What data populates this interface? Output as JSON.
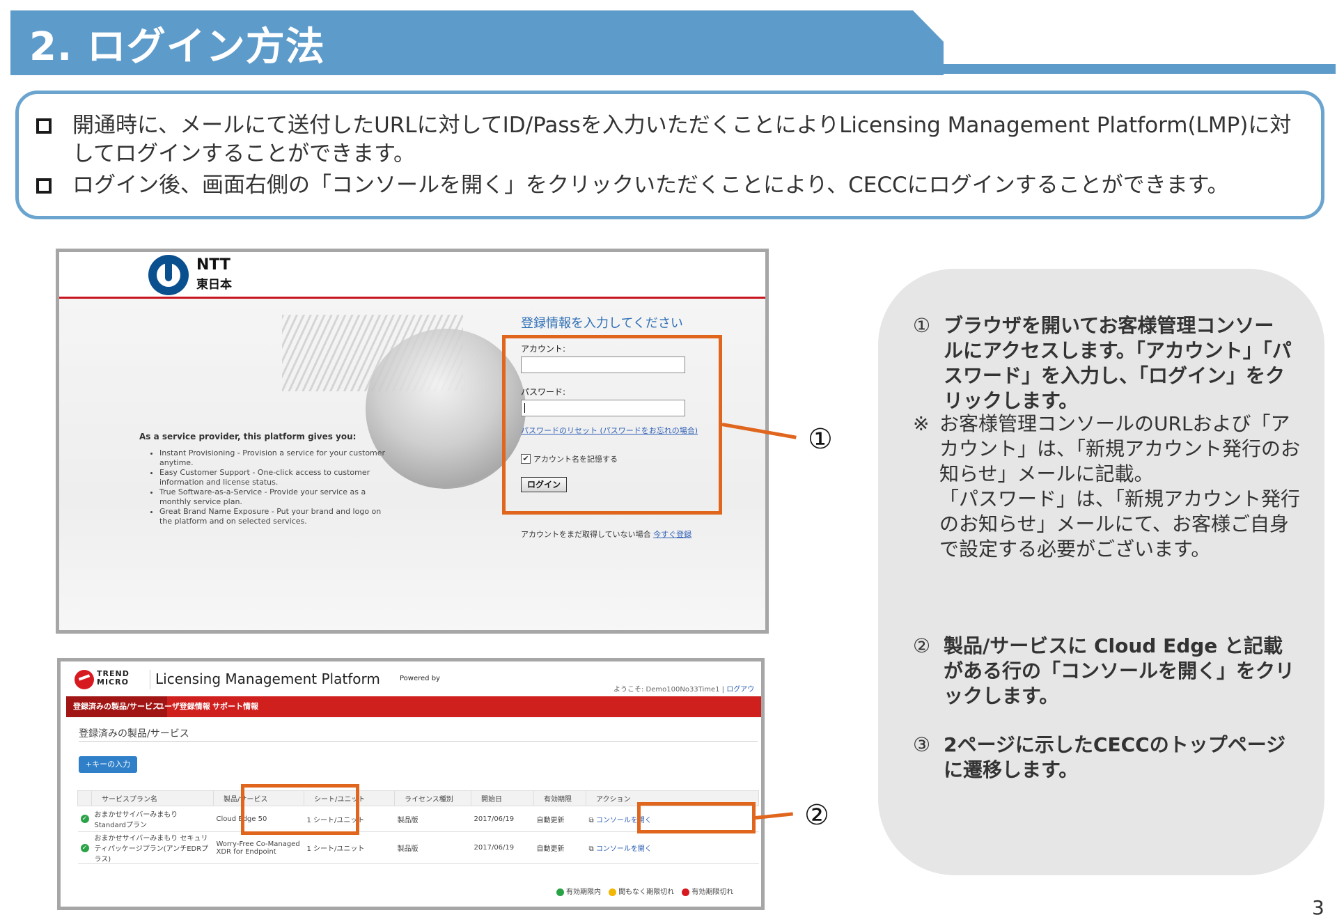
{
  "header": {
    "title": "2.  ログイン方法",
    "band_color": "#5d9bcb"
  },
  "intro": {
    "bullets": [
      "開通時に、メールにて送付したURLに対してID/Passを入力いただくことによりLicensing Management Platform(LMP)に対してログインすることができます。",
      "ログイン後、画面右側の「コンソールを開く」をクリックいただくことにより、CECCにログインすることができます。"
    ]
  },
  "login_screen": {
    "logo_line1": "NTT",
    "logo_line2": "東日本",
    "heading": "登録情報を入力してください",
    "account_label": "アカウント:",
    "password_label": "パスワード:",
    "password_reset": "パスワードのリセット (パスワードをお忘れの場合)",
    "remember_label": "アカウント名を記憶する",
    "remember_checked": true,
    "login_button": "ログイン",
    "no_account_text": "アカウントをまだ取得していない場合",
    "register_link": "今すぐ登録",
    "provider_title": "As a service provider, this platform gives you:",
    "provider_points": [
      "Instant Provisioning - Provision a service for your customer anytime.",
      "Easy Customer Support - One-click access to customer information and license status.",
      "True Software-as-a-Service - Provide your service as a monthly service plan.",
      "Great Brand Name Exposure - Put your brand and logo on the platform and on selected services."
    ]
  },
  "lmp_screen": {
    "brand": "TREND MICRO",
    "title": "Licensing Management Platform",
    "powered_by": "Powered by",
    "welcome": "ようこそ: Demo100No33Time1 |",
    "logout": "ログアウト",
    "tabs": [
      "登録済みの製品/サービス",
      "ユーザ登録情報",
      "サポート情報"
    ],
    "section_title": "登録済みの製品/サービス",
    "key_button": "+キーの入力",
    "columns": [
      "サービスプラン名",
      "製品/サービス",
      "シート/ユニット",
      "ライセンス種別",
      "開始日",
      "有効期限",
      "アクション"
    ],
    "rows": [
      {
        "plan": "おまかせサイバーみまもり Standardプラン",
        "product": "Cloud Edge 50",
        "seats": "1 シート/ユニット",
        "license": "製品版",
        "start": "2017/06/19",
        "expiry": "自動更新",
        "action": "コンソールを開く"
      },
      {
        "plan": "おまかせサイバーみまもり セキュリティパッケージプラン(アンチEDRプラス)",
        "product": "Worry-Free Co-Managed XDR for Endpoint",
        "seats": "1 シート/ユニット",
        "license": "製品版",
        "start": "2017/06/19",
        "expiry": "自動更新",
        "action": "コンソールを開く"
      }
    ],
    "legend": [
      "有効期限内",
      "間もなく期限切れ",
      "有効期限切れ"
    ],
    "legend_colors": [
      "#2aa246",
      "#f2b705",
      "#d71920"
    ]
  },
  "callouts": {
    "one": "①",
    "two": "②",
    "accent_color": "#e0661e"
  },
  "panel": {
    "step1_num": "①",
    "step1": "ブラウザを開いてお客様管理コンソールにアクセスします。「アカウント」「パスワード」を入力し、「ログイン」をクリックします。",
    "note_mark": "※",
    "note_line1": "お客様管理コンソールのURLおよび「アカウント」は、「新規アカウント発行のお知らせ」メールに記載。",
    "note_line2": "「パスワード」は、「新規アカウント発行のお知らせ」メールにて、お客様ご自身で設定する必要がございます。",
    "step2_num": "②",
    "step2": "製品/サービスに Cloud Edge と記載がある行の「コンソールを開く」をクリックします。",
    "step3_num": "③",
    "step3": "2ページに示したCECCのトップページに遷移します。"
  },
  "page_number": "3"
}
